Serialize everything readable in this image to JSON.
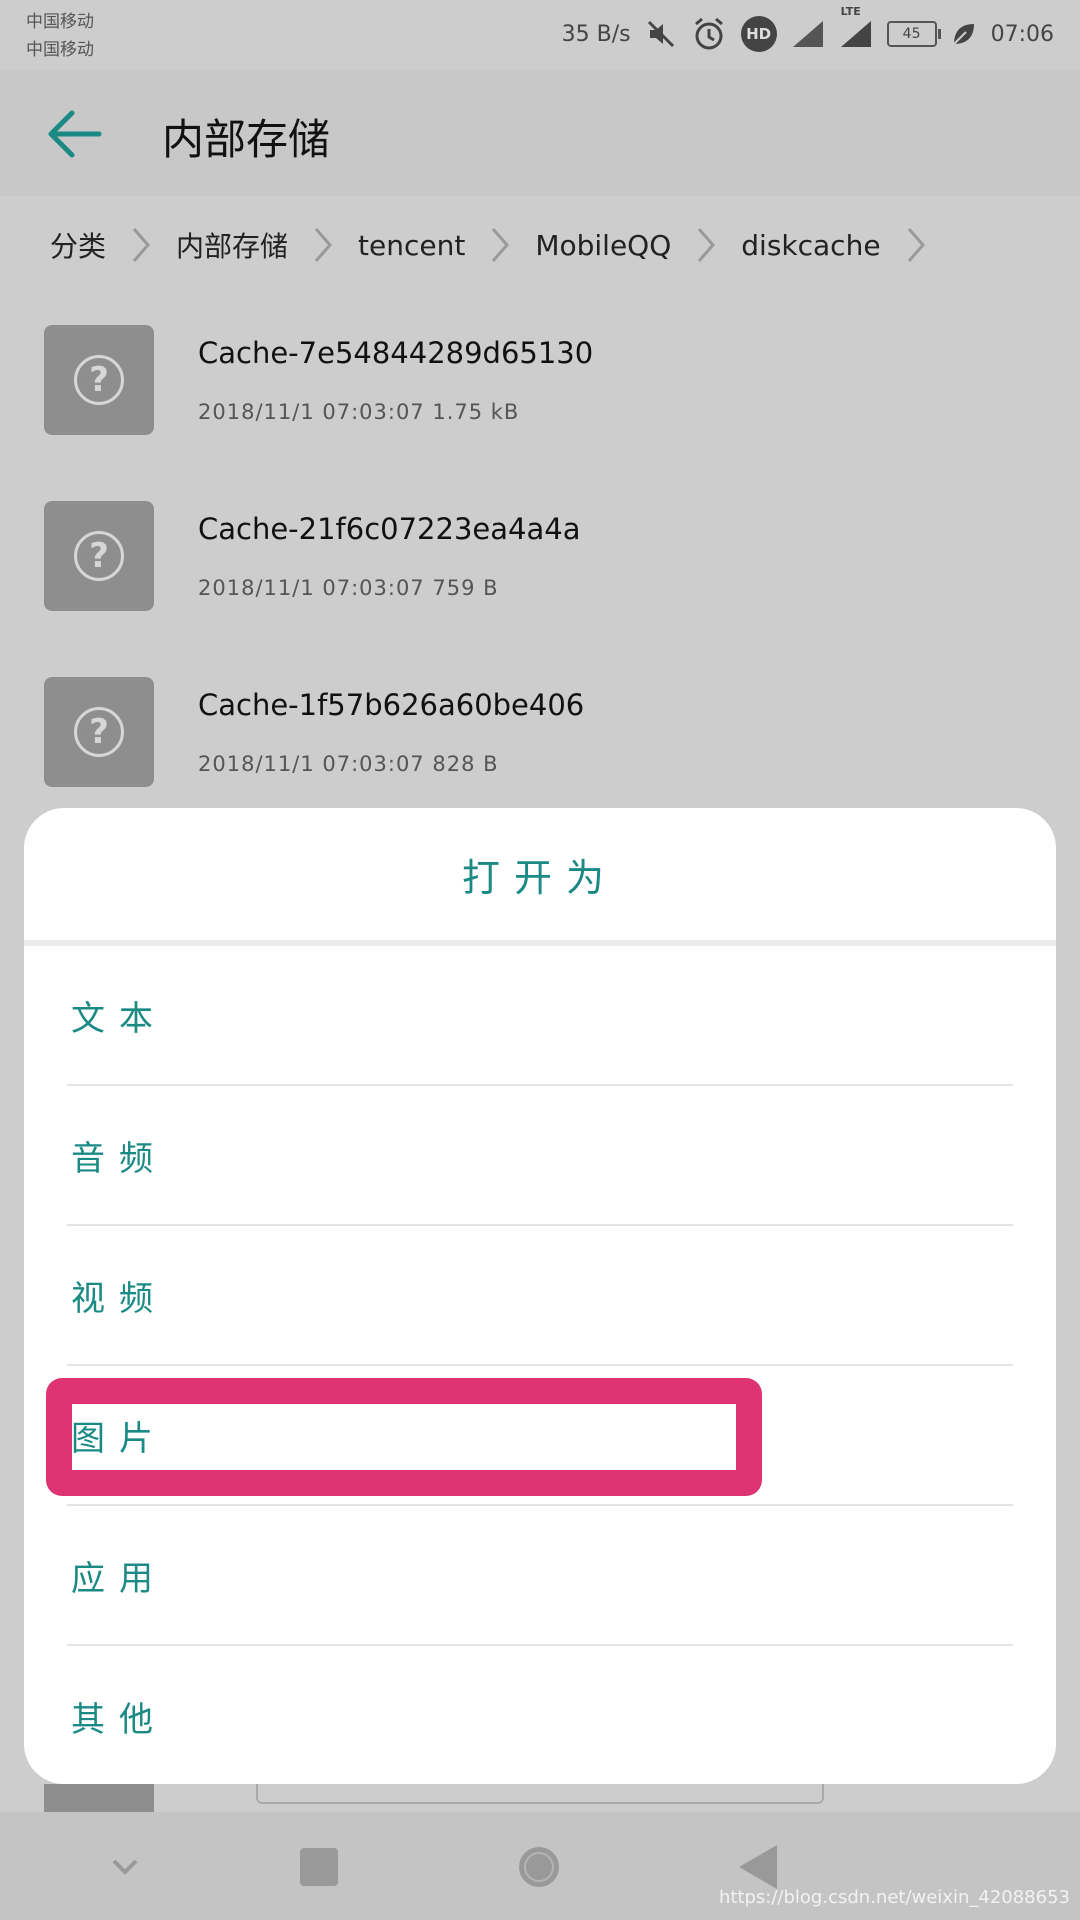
{
  "status_bar": {
    "carrier_1": "中国移动",
    "carrier_2": "中国移动",
    "net_speed": "35 B/s",
    "hd_badge": "HD",
    "lte_label": "LTE",
    "battery": "45",
    "time": "07:06"
  },
  "app_bar": {
    "title": "内部存储"
  },
  "breadcrumb": [
    "分类",
    "内部存储",
    "tencent",
    "MobileQQ",
    "diskcache"
  ],
  "files": [
    {
      "name": "Cache-7e54844289d65130",
      "meta": "2018/11/1 07:03:07 1.75 kB"
    },
    {
      "name": "Cache-21f6c07223ea4a4a",
      "meta": "2018/11/1 07:03:07 759 B"
    },
    {
      "name": "Cache-1f57b626a60be406",
      "meta": "2018/11/1 07:03:07 828 B"
    }
  ],
  "dialog": {
    "title": "打开为",
    "options": [
      "文本",
      "音频",
      "视频",
      "图片",
      "应用",
      "其他"
    ]
  },
  "colors": {
    "accent": "#1b8a84",
    "highlight": "#de3473"
  },
  "watermark": "https://blog.csdn.net/weixin_42088653"
}
